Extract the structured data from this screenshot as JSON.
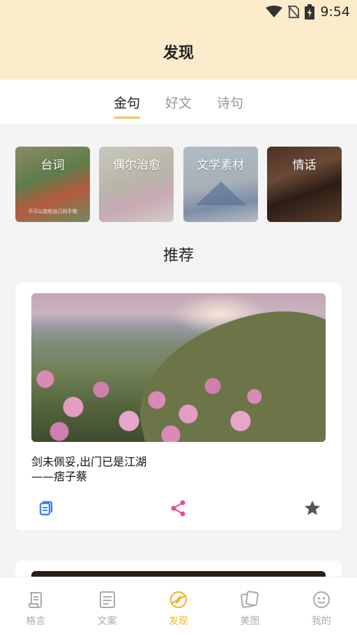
{
  "status_bar": {
    "time": "9:54"
  },
  "header": {
    "title": "发现"
  },
  "tabs": [
    {
      "label": "金句",
      "active": true
    },
    {
      "label": "好文",
      "active": false
    },
    {
      "label": "诗句",
      "active": false
    }
  ],
  "categories": [
    {
      "label": "台词",
      "caption": "不可以放松自己的手哦"
    },
    {
      "label": "偶尔治愈"
    },
    {
      "label": "文学素材"
    },
    {
      "label": "情话"
    }
  ],
  "section": {
    "title": "推荐"
  },
  "card": {
    "line1": "剑未佩妥,出门已是江湖",
    "line2": "——痞子蔡",
    "actions": [
      "copy-icon",
      "share-icon",
      "star-icon"
    ]
  },
  "bottom_nav": [
    {
      "label": "格言",
      "icon": "scroll-icon",
      "active": false
    },
    {
      "label": "文案",
      "icon": "document-icon",
      "active": false
    },
    {
      "label": "发现",
      "icon": "compass-icon",
      "active": true
    },
    {
      "label": "美图",
      "icon": "pictures-icon",
      "active": false
    },
    {
      "label": "我的",
      "icon": "face-icon",
      "active": false
    }
  ],
  "colors": {
    "header_bg": "#fdeccb",
    "accent": "#f1b52e",
    "copy": "#3b82f6",
    "share": "#ec4899",
    "star": "#555555"
  }
}
